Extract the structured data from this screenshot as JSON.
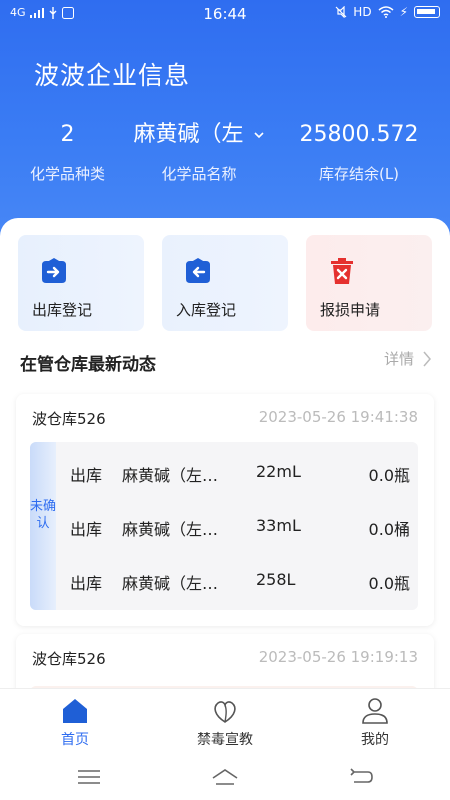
{
  "status_bar": {
    "signal": "4G",
    "time": "16:44",
    "right": "HD"
  },
  "header": {
    "title": "波波企业信息",
    "stats": [
      {
        "value": "2",
        "label": "化学品种类"
      },
      {
        "value": "麻黄碱（左",
        "label": "化学品名称"
      },
      {
        "value": "25800.572",
        "label": "库存结余(L)"
      }
    ]
  },
  "quick_actions": [
    {
      "label": "出库登记",
      "icon": "arrow-right-box-icon",
      "color": "#1f5fd6"
    },
    {
      "label": "入库登记",
      "icon": "arrow-left-box-icon",
      "color": "#1f5fd6"
    },
    {
      "label": "报损申请",
      "icon": "trash-x-icon",
      "color": "#e5312f"
    }
  ],
  "section": {
    "title": "在管仓库最新动态",
    "more": "详情"
  },
  "cards": [
    {
      "warehouse": "波仓库526",
      "time": "2023-05-26 19:41:38",
      "status": "未确认",
      "rows": [
        {
          "op": "出库",
          "name": "麻黄碱（左…",
          "qty": "22mL",
          "stock": "0.0瓶"
        },
        {
          "op": "出库",
          "name": "麻黄碱（左…",
          "qty": "33mL",
          "stock": "0.0桶"
        },
        {
          "op": "出库",
          "name": "麻黄碱（左…",
          "qty": "258L",
          "stock": "0.0瓶"
        }
      ]
    },
    {
      "warehouse": "波仓库526",
      "time": "2023-05-26 19:19:13"
    }
  ],
  "tabs": [
    {
      "label": "首页",
      "icon": "home-icon",
      "active": true
    },
    {
      "label": "禁毒宣教",
      "icon": "heart-leaf-icon",
      "active": false
    },
    {
      "label": "我的",
      "icon": "user-icon",
      "active": false
    }
  ],
  "colors": {
    "primary": "#2f6df0",
    "danger": "#e5312f"
  }
}
